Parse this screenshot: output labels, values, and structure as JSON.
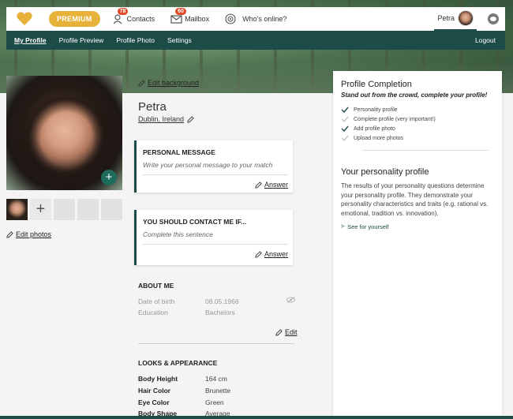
{
  "topbar": {
    "premium_label": "PREMIUM",
    "nav": [
      {
        "label": "Contacts",
        "badge": "78"
      },
      {
        "label": "Mailbox",
        "badge": "60"
      },
      {
        "label": "Who's online?",
        "badge": ""
      }
    ],
    "user_name": "Petra"
  },
  "subnav": {
    "items": [
      "My Profile",
      "Profile Preview",
      "Profile Photo",
      "Settings"
    ],
    "logout": "Logout"
  },
  "left": {
    "edit_photos": "Edit photos"
  },
  "profile": {
    "edit_background": "Edit background",
    "name": "Petra",
    "location": "Dublin, Ireland",
    "personal_message": {
      "title": "PERSONAL MESSAGE",
      "placeholder": "Write your personal message to your match",
      "action": "Answer"
    },
    "contact_me": {
      "title": "YOU SHOULD CONTACT ME IF...",
      "placeholder": "Complete this sentence",
      "action": "Answer"
    },
    "about": {
      "title": "ABOUT ME",
      "rows": [
        {
          "k": "Date of birth",
          "v": "08.05.1966"
        },
        {
          "k": "Education",
          "v": "Bachelors"
        }
      ],
      "edit": "Edit"
    },
    "looks": {
      "title": "LOOKS & APPEARANCE",
      "rows": [
        {
          "k": "Body Height",
          "v": "164 cm"
        },
        {
          "k": "Hair Color",
          "v": "Brunette"
        },
        {
          "k": "Eye Color",
          "v": "Green"
        },
        {
          "k": "Body Shape",
          "v": "Average"
        }
      ]
    }
  },
  "panel": {
    "title": "Profile Completion",
    "subtitle": "Stand out from the crowd, complete your profile!",
    "checks": [
      {
        "label": "Personality profile",
        "done": true
      },
      {
        "label": "Complete profile (very important!)",
        "done": false
      },
      {
        "label": "Add profile photo",
        "done": true
      },
      {
        "label": "Upload more photos",
        "done": false
      }
    ],
    "pers_title": "Your personality profile",
    "pers_text": "The results of your personality questions determine your personality profile. They demonstrate your personality characteristics and traits (e.g. rational vs. emotional, tradition vs. innovation).",
    "see": "See for yourself"
  },
  "colors": {
    "primary": "#1d4b47",
    "premium": "#e6b23a",
    "badge": "#e24a2a"
  }
}
